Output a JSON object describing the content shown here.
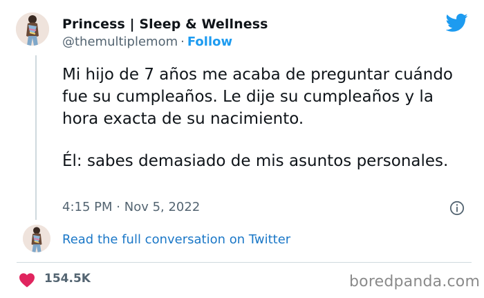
{
  "author": {
    "display_name": "Princess | Sleep & Wellness",
    "handle": "@themultiplemom",
    "separator": "·",
    "follow_label": "Follow"
  },
  "tweet": {
    "paragraph_1": "Mi hijo de 7 años me acaba de preguntar cuándo fue su cumpleaños. Le dije su cumpleaños y la hora exacta de su nacimiento.",
    "paragraph_2": "Él: sabes demasiado de mis asuntos personales.",
    "time": "4:15 PM",
    "date_separator": "·",
    "date": "Nov 5, 2022"
  },
  "conversation_link": "Read the full conversation on Twitter",
  "likes": {
    "count": "154.5K",
    "icon": "heart-icon",
    "color": "#e0245e"
  },
  "watermark": "boredpanda.com",
  "colors": {
    "link_blue": "#1d9bf0",
    "twitter_blue": "#1d9bf0",
    "muted": "#536471",
    "heart": "#e0245e"
  }
}
